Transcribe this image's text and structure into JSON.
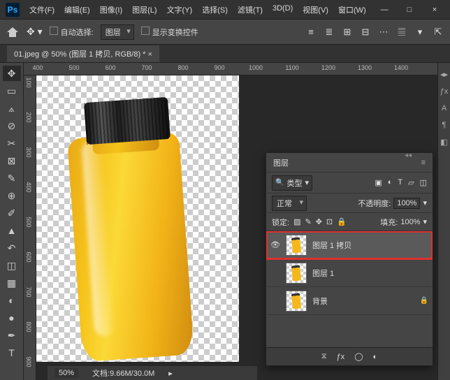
{
  "app": {
    "logo": "Ps"
  },
  "menu": [
    "文件(F)",
    "编辑(E)",
    "图像(I)",
    "图层(L)",
    "文字(Y)",
    "选择(S)",
    "滤镜(T)",
    "3D(D)",
    "视图(V)",
    "窗口(W)"
  ],
  "win": {
    "min": "—",
    "max": "□",
    "close": "×"
  },
  "options": {
    "auto_select": "自动选择:",
    "layer": "图层",
    "show_transform": "显示变换控件"
  },
  "tab": {
    "label": "01.jpeg @ 50% (图层 1 拷贝, RGB/8) *"
  },
  "ruler_h": [
    400,
    500,
    600,
    700,
    800,
    900,
    1000,
    1100,
    1200,
    1300,
    1400
  ],
  "ruler_v": [
    100,
    200,
    300,
    400,
    500,
    600,
    700,
    800,
    900
  ],
  "status": {
    "zoom": "50%",
    "doc": "文档:9.66M/30.0M"
  },
  "layers_panel": {
    "title": "图层",
    "filter_label": "类型",
    "blend": "正常",
    "opacity_label": "不透明度:",
    "opacity": "100%",
    "lock_label": "锁定:",
    "fill_label": "填充:",
    "fill": "100%",
    "layers": [
      {
        "name": "图层 1 拷贝",
        "visible": true,
        "locked": false,
        "selected": true
      },
      {
        "name": "图层 1",
        "visible": false,
        "locked": false,
        "selected": false
      },
      {
        "name": "背景",
        "visible": false,
        "locked": true,
        "selected": false
      }
    ]
  }
}
